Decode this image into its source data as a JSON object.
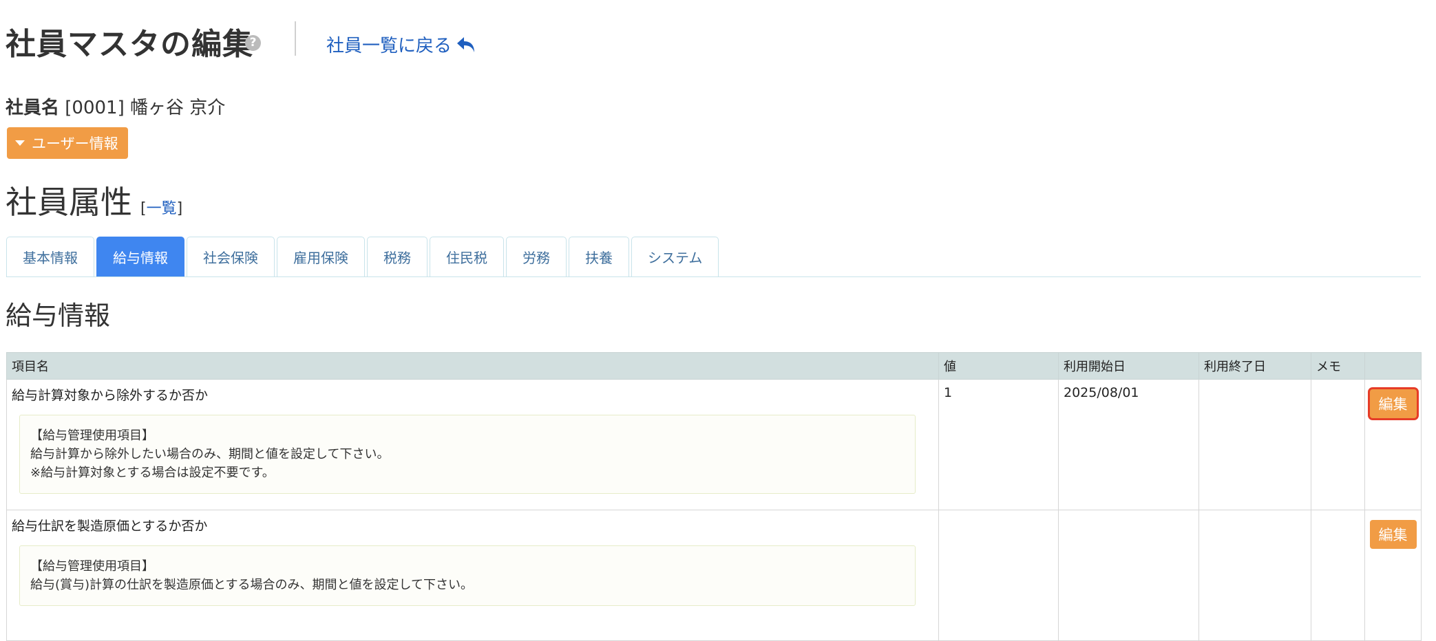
{
  "header": {
    "title": "社員マスタの編集",
    "help_icon": "?",
    "back_link_label": "社員一覧に戻る"
  },
  "employee": {
    "name_label": "社員名",
    "code": "[0001]",
    "name": "幡ヶ谷 京介"
  },
  "user_info_button": "ユーザー情報",
  "attributes": {
    "heading": "社員属性",
    "list_bracket_open": "[",
    "list_link": "一覧",
    "list_bracket_close": "]"
  },
  "tabs": [
    {
      "label": "基本情報",
      "active": false
    },
    {
      "label": "給与情報",
      "active": true
    },
    {
      "label": "社会保険",
      "active": false
    },
    {
      "label": "雇用保険",
      "active": false
    },
    {
      "label": "税務",
      "active": false
    },
    {
      "label": "住民税",
      "active": false
    },
    {
      "label": "労務",
      "active": false
    },
    {
      "label": "扶養",
      "active": false
    },
    {
      "label": "システム",
      "active": false
    }
  ],
  "section_title": "給与情報",
  "table": {
    "columns": [
      "項目名",
      "値",
      "利用開始日",
      "利用終了日",
      "メモ",
      ""
    ],
    "rows": [
      {
        "item": "給与計算対象から除外するか否か",
        "note": [
          "【給与管理使用項目】",
          "給与計算から除外したい場合のみ、期間と値を設定して下さい。",
          "※給与計算対象とする場合は設定不要です。"
        ],
        "value": "1",
        "start": "2025/08/01",
        "end": "",
        "memo": "",
        "edit_label": "編集"
      },
      {
        "item": "給与仕訳を製造原価とするか否か",
        "note": [
          "【給与管理使用項目】",
          "給与(賞与)計算の仕訳を製造原価とする場合のみ、期間と値を設定して下さい。"
        ],
        "value": "",
        "start": "",
        "end": "",
        "memo": "",
        "edit_label": "編集"
      }
    ]
  },
  "colors": {
    "accent_orange": "#f19c45",
    "active_tab_blue": "#3f86f0",
    "link_blue": "#1f5fbf",
    "highlight_red": "#e63c27"
  },
  "icons": {
    "help": "question-circle-icon",
    "back": "reply-arrow-icon",
    "caret": "caret-down-icon"
  }
}
